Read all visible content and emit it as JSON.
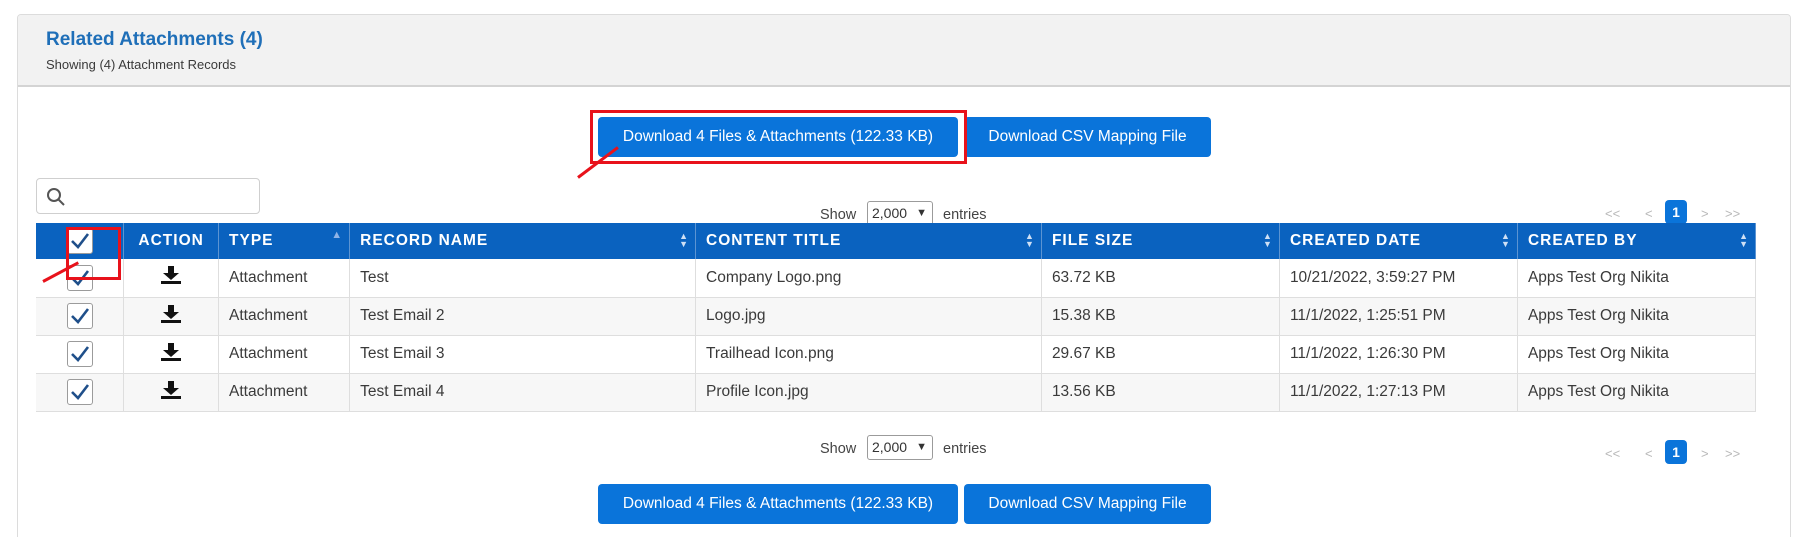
{
  "header": {
    "title": "Related Attachments (4)",
    "subtitle": "Showing (4) Attachment Records"
  },
  "buttons": {
    "download_files": "Download 4 Files & Attachments (122.33 KB)",
    "download_csv": "Download CSV Mapping File"
  },
  "search": {
    "placeholder": ""
  },
  "paging": {
    "show_label": "Show",
    "entries_value": "2,000",
    "entries_label": "entries",
    "first": "<<",
    "prev": "<",
    "current_page": "1",
    "next": ">",
    "last": ">>"
  },
  "table": {
    "columns": [
      "ACTION",
      "TYPE",
      "RECORD NAME",
      "CONTENT TITLE",
      "FILE SIZE",
      "CREATED DATE",
      "CREATED BY"
    ],
    "rows": [
      {
        "type": "Attachment",
        "record_name": "Test",
        "content_title": "Company Logo.png",
        "file_size": "63.72 KB",
        "created_date": "10/21/2022, 3:59:27 PM",
        "created_by": "Apps Test Org Nikita"
      },
      {
        "type": "Attachment",
        "record_name": "Test Email 2",
        "content_title": "Logo.jpg",
        "file_size": "15.38 KB",
        "created_date": "11/1/2022, 1:25:51 PM",
        "created_by": "Apps Test Org Nikita"
      },
      {
        "type": "Attachment",
        "record_name": "Test Email 3",
        "content_title": "Trailhead Icon.png",
        "file_size": "29.67 KB",
        "created_date": "11/1/2022, 1:26:30 PM",
        "created_by": "Apps Test Org Nikita"
      },
      {
        "type": "Attachment",
        "record_name": "Test Email 4",
        "content_title": "Profile Icon.jpg",
        "file_size": "13.56 KB",
        "created_date": "11/1/2022, 1:27:13 PM",
        "created_by": "Apps Test Org Nikita"
      }
    ]
  },
  "icons": {
    "search": "search-icon",
    "download": "download-icon",
    "checkbox": "checkmark-icon"
  },
  "colors": {
    "accent": "#0a74da",
    "header_bar": "#0a62bf",
    "link": "#1f6fb8",
    "highlight": "#e8121b"
  }
}
